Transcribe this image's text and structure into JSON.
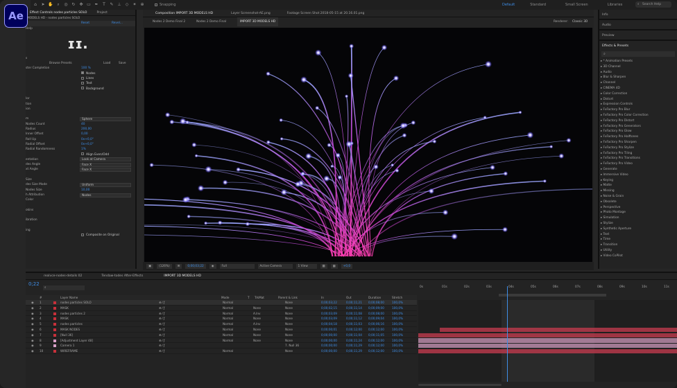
{
  "app": {
    "logo": "Ae"
  },
  "menubar": {
    "snapping": "Snapping",
    "workspaces": [
      "Default",
      "Standard",
      "Small Screen",
      "Libraries"
    ],
    "search": "Search Help",
    "tools": [
      "home-icon",
      "arrow-icon",
      "hand-icon",
      "zoom-icon",
      "camera-icon",
      "rotate-icon",
      "pan-icon",
      "rect-icon",
      "pen-icon",
      "type-icon",
      "brush-icon",
      "stamp-icon",
      "eraser-icon",
      "puppet-icon",
      "pin-icon"
    ]
  },
  "left_panel": {
    "tabs": [
      "Effect Controls nodes particles SOLO",
      "Project"
    ],
    "subtitle": "MODELS HD - nodes particles SOLO",
    "columns": [
      "Reset",
      "Revel..."
    ],
    "help": "Help",
    "logo": "ɪɪ.",
    "presets": {
      "browse": "Browse Presets",
      "load": "Load",
      "save": "Save"
    },
    "rows": [
      {
        "label": "ster Completion",
        "value": "100 %"
      },
      {
        "label": "",
        "check": "Nodes",
        "on": true
      },
      {
        "label": "",
        "check": "Lines",
        "on": false
      },
      {
        "label": "",
        "check": "Text",
        "on": false
      },
      {
        "label": "",
        "check": "Background",
        "on": false
      },
      {
        "label": ""
      },
      {
        "label": "lor"
      },
      {
        "label": "tion"
      },
      {
        "label": "ion"
      },
      {
        "label": ""
      },
      {
        "label": "m",
        "select": "Sphere"
      },
      {
        "label": "Nodes Count",
        "value": "40"
      },
      {
        "label": "Radius",
        "value": "200,00"
      },
      {
        "label": "Inner Offset",
        "value": "0,00"
      },
      {
        "label": "Roll Up",
        "value": "0x+0,0°"
      },
      {
        "label": "Radial Offset",
        "value": "0x+0,0°"
      },
      {
        "label": "Radial Randomness",
        "value": "1%"
      },
      {
        "label": "",
        "check": "Align Even/Odd",
        "on": false
      },
      {
        "label": "entation",
        "select": "Look at Camera"
      },
      {
        "label": "des Angle",
        "select": "Face X"
      },
      {
        "label": "xt Angle",
        "select": "Face X"
      },
      {
        "label": ""
      },
      {
        "label": "Size"
      },
      {
        "label": "des Size Mode",
        "select": "Uniform"
      },
      {
        "label": "Nodes Size",
        "value": "10,00"
      },
      {
        "label": "h Attribution",
        "select": "Nodes"
      },
      {
        "label": "Color"
      },
      {
        "label": ""
      },
      {
        "label": "okins"
      },
      {
        "label": ""
      },
      {
        "label": "ibration"
      },
      {
        "label": ""
      },
      {
        "label": "ing"
      },
      {
        "label": "",
        "check": "Composite on Original",
        "on": false
      }
    ]
  },
  "comp_panel": {
    "tabs": [
      "Composition IMPORT 3D MODELS HD",
      "Layer Screenshot-AE.png",
      "Footage Screen Shot 2018-05-15 at 20.16.01.png"
    ],
    "breadcrumbs": [
      "Nodes 2 Demo Final 2",
      "Nodes 2 Demo Final",
      "IMPORT 3D MODELS HD"
    ],
    "renderer_label": "Renderer:",
    "renderer": "Classic 3D",
    "viewer_bar": {
      "zoom": "(126%)",
      "time": "0;00;03;22",
      "resolution": "Full",
      "camera": "Active Camera",
      "views": "1 View",
      "plus": "+0,0"
    }
  },
  "right_panel": {
    "panels": [
      "Info",
      "Audio",
      "Preview"
    ],
    "effects_title": "Effects & Presets",
    "effects": [
      "* Animation Presets",
      "3D Channel",
      "Audio",
      "Blur & Sharpen",
      "Channel",
      "CINEMA 4D",
      "Color Correction",
      "Distort",
      "Expression Controls",
      "FxFactory Pro Blur",
      "FxFactory Pro Color Correction",
      "FxFactory Pro Distort",
      "FxFactory Pro Generators",
      "FxFactory Pro Glow",
      "FxFactory Pro Halftones",
      "FxFactory Pro Sharpen",
      "FxFactory Pro Stylize",
      "FxFactory Pro Tiling",
      "FxFactory Pro Transitions",
      "FxFactory Pro Video",
      "Generate",
      "Immersive Video",
      "Keying",
      "Matte",
      "Missing",
      "Noise & Grain",
      "Obsolete",
      "Perspective",
      "Photo Montage",
      "Simulation",
      "Stylize",
      "Synthetic Aperture",
      "Text",
      "Time",
      "Transition",
      "Utility",
      "Video CoPilot"
    ]
  },
  "timeline": {
    "tabs": [
      "realvce-nodes-details 02",
      "Tendaw-todes After-Effects",
      "IMPORT 3D MODELS HD"
    ],
    "current_time": "0;22",
    "headers": [
      "#",
      "Layer Name",
      "Mode",
      "T",
      "TrkMat",
      "Parent & Link",
      "In",
      "Out",
      "Duration",
      "Stretch"
    ],
    "layers": [
      {
        "num": "1",
        "name": "nodes particles SOLO",
        "mode": "Normal",
        "trk": "",
        "parent": "None",
        "in": "0;00;03;22",
        "out": "0;00;11;21",
        "dur": "0;00;08;00",
        "str": "100,0%",
        "color": "#c8303a"
      },
      {
        "num": "2",
        "name": "MASK",
        "mode": "Normal",
        "trk": "None",
        "parent": "None",
        "in": "0;00;02;15",
        "out": "0;00;11;14",
        "dur": "0;00;09;00",
        "str": "100,0%",
        "color": "#c8303a"
      },
      {
        "num": "3",
        "name": "nodes particles 2",
        "mode": "Normal",
        "trk": "A.Inv",
        "parent": "None",
        "in": "0;00;03;09",
        "out": "0;00;11;08",
        "dur": "0;00;08;00",
        "str": "100,0%",
        "color": "#c8303a"
      },
      {
        "num": "4",
        "name": "MASK",
        "mode": "Normal",
        "trk": "None",
        "parent": "None",
        "in": "0;00;03;09",
        "out": "0;00;11;12",
        "dur": "0;00;09;04",
        "str": "100,0%",
        "color": "#c8303a"
      },
      {
        "num": "5",
        "name": "nodes particles",
        "mode": "Normal",
        "trk": "A.Inv",
        "parent": "None",
        "in": "0;00;04;18",
        "out": "0;00;11;03",
        "dur": "0;00;06;16",
        "str": "100,0%",
        "color": "#c8303a"
      },
      {
        "num": "6",
        "name": "MASK NODES",
        "mode": "Normal",
        "trk": "None",
        "parent": "None",
        "in": "0;00;00;01",
        "out": "0;00;12;00",
        "dur": "0;00;12;00",
        "str": "100,0%",
        "color": "#c8303a"
      },
      {
        "num": "7",
        "name": "[Null 36]",
        "mode": "Normal",
        "trk": "None",
        "parent": "None",
        "in": "0;00;00;00",
        "out": "0;00;11;04",
        "dur": "0;00;11;05",
        "str": "100,0%",
        "color": "#c8303a"
      },
      {
        "num": "8",
        "name": "[Adjustment Layer 48]",
        "mode": "Normal",
        "trk": "None",
        "parent": "None",
        "in": "0;00;00;00",
        "out": "0;00;11;24",
        "dur": "0;00;12;00",
        "str": "100,0%",
        "color": "#d8a0c8"
      },
      {
        "num": "9",
        "name": "Camera 1",
        "mode": "",
        "trk": "",
        "parent": "7. Null 36",
        "in": "0;00;00;00",
        "out": "0;00;11;29",
        "dur": "0;00;12;00",
        "str": "100,0%",
        "color": "#d8a0c8"
      },
      {
        "num": "10",
        "name": "WIREFRAME",
        "mode": "Normal",
        "trk": "",
        "parent": "None",
        "in": "0;00;00;00",
        "out": "0;00;11;29",
        "dur": "0;00;12;00",
        "str": "100,0%",
        "color": "#c8303a"
      }
    ],
    "ruler": [
      "0s",
      "01s",
      "02s",
      "03s",
      "04s",
      "05s",
      "06s",
      "07s",
      "08s",
      "09s",
      "10s",
      "11s"
    ]
  }
}
